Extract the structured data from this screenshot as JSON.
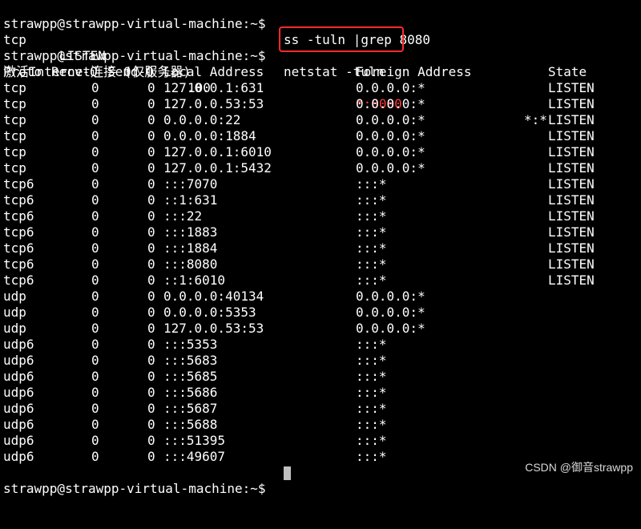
{
  "ss_command_line": {
    "prompt": "strawpp@strawpp-virtual-machine:~$",
    "command": "ss -tuln |grep 8080"
  },
  "ss_output": {
    "netid": "tcp",
    "state": "LISTEN",
    "recvq": "0",
    "sendq": "100",
    "local": "*:8080",
    "peer": "*:*"
  },
  "netstat_command_line": {
    "prompt": "strawpp@strawpp-virtual-machine:~$",
    "command": "netstat -tuln"
  },
  "netstat_title": "激活Internet连接 (仅服务器)",
  "columns": {
    "proto": "Proto",
    "recvq": "Recv-Q",
    "sendq": "Send-Q",
    "local": "Local Address",
    "foreign": "Foreign Address",
    "state": "State"
  },
  "rows": [
    {
      "proto": "tcp",
      "recvq": "0",
      "sendq": "0",
      "local": "127.0.0.1:631",
      "foreign": "0.0.0.0:*",
      "state": "LISTEN"
    },
    {
      "proto": "tcp",
      "recvq": "0",
      "sendq": "0",
      "local": "127.0.0.53:53",
      "foreign": "0.0.0.0:*",
      "state": "LISTEN"
    },
    {
      "proto": "tcp",
      "recvq": "0",
      "sendq": "0",
      "local": "0.0.0.0:22",
      "foreign": "0.0.0.0:*",
      "state": "LISTEN"
    },
    {
      "proto": "tcp",
      "recvq": "0",
      "sendq": "0",
      "local": "0.0.0.0:1884",
      "foreign": "0.0.0.0:*",
      "state": "LISTEN"
    },
    {
      "proto": "tcp",
      "recvq": "0",
      "sendq": "0",
      "local": "127.0.0.1:6010",
      "foreign": "0.0.0.0:*",
      "state": "LISTEN"
    },
    {
      "proto": "tcp",
      "recvq": "0",
      "sendq": "0",
      "local": "127.0.0.1:5432",
      "foreign": "0.0.0.0:*",
      "state": "LISTEN"
    },
    {
      "proto": "tcp6",
      "recvq": "0",
      "sendq": "0",
      "local": ":::7070",
      "foreign": ":::*",
      "state": "LISTEN"
    },
    {
      "proto": "tcp6",
      "recvq": "0",
      "sendq": "0",
      "local": "::1:631",
      "foreign": ":::*",
      "state": "LISTEN"
    },
    {
      "proto": "tcp6",
      "recvq": "0",
      "sendq": "0",
      "local": ":::22",
      "foreign": ":::*",
      "state": "LISTEN"
    },
    {
      "proto": "tcp6",
      "recvq": "0",
      "sendq": "0",
      "local": ":::1883",
      "foreign": ":::*",
      "state": "LISTEN"
    },
    {
      "proto": "tcp6",
      "recvq": "0",
      "sendq": "0",
      "local": ":::1884",
      "foreign": ":::*",
      "state": "LISTEN"
    },
    {
      "proto": "tcp6",
      "recvq": "0",
      "sendq": "0",
      "local": ":::8080",
      "foreign": ":::*",
      "state": "LISTEN"
    },
    {
      "proto": "tcp6",
      "recvq": "0",
      "sendq": "0",
      "local": "::1:6010",
      "foreign": ":::*",
      "state": "LISTEN"
    },
    {
      "proto": "udp",
      "recvq": "0",
      "sendq": "0",
      "local": "0.0.0.0:40134",
      "foreign": "0.0.0.0:*",
      "state": ""
    },
    {
      "proto": "udp",
      "recvq": "0",
      "sendq": "0",
      "local": "0.0.0.0:5353",
      "foreign": "0.0.0.0:*",
      "state": ""
    },
    {
      "proto": "udp",
      "recvq": "0",
      "sendq": "0",
      "local": "127.0.0.53:53",
      "foreign": "0.0.0.0:*",
      "state": ""
    },
    {
      "proto": "udp6",
      "recvq": "0",
      "sendq": "0",
      "local": ":::5353",
      "foreign": ":::*",
      "state": ""
    },
    {
      "proto": "udp6",
      "recvq": "0",
      "sendq": "0",
      "local": ":::5683",
      "foreign": ":::*",
      "state": ""
    },
    {
      "proto": "udp6",
      "recvq": "0",
      "sendq": "0",
      "local": ":::5685",
      "foreign": ":::*",
      "state": ""
    },
    {
      "proto": "udp6",
      "recvq": "0",
      "sendq": "0",
      "local": ":::5686",
      "foreign": ":::*",
      "state": ""
    },
    {
      "proto": "udp6",
      "recvq": "0",
      "sendq": "0",
      "local": ":::5687",
      "foreign": ":::*",
      "state": ""
    },
    {
      "proto": "udp6",
      "recvq": "0",
      "sendq": "0",
      "local": ":::5688",
      "foreign": ":::*",
      "state": ""
    },
    {
      "proto": "udp6",
      "recvq": "0",
      "sendq": "0",
      "local": ":::51395",
      "foreign": ":::*",
      "state": ""
    },
    {
      "proto": "udp6",
      "recvq": "0",
      "sendq": "0",
      "local": ":::49607",
      "foreign": ":::*",
      "state": ""
    }
  ],
  "final_prompt": "strawpp@strawpp-virtual-machine:~$",
  "watermark": "CSDN @御音strawpp",
  "colors": {
    "background": "#000000",
    "text": "#ffffff",
    "highlight_border": "#ff2a2a",
    "grep_match": "#ff3b3b",
    "cursor": "#c0c0c0"
  }
}
